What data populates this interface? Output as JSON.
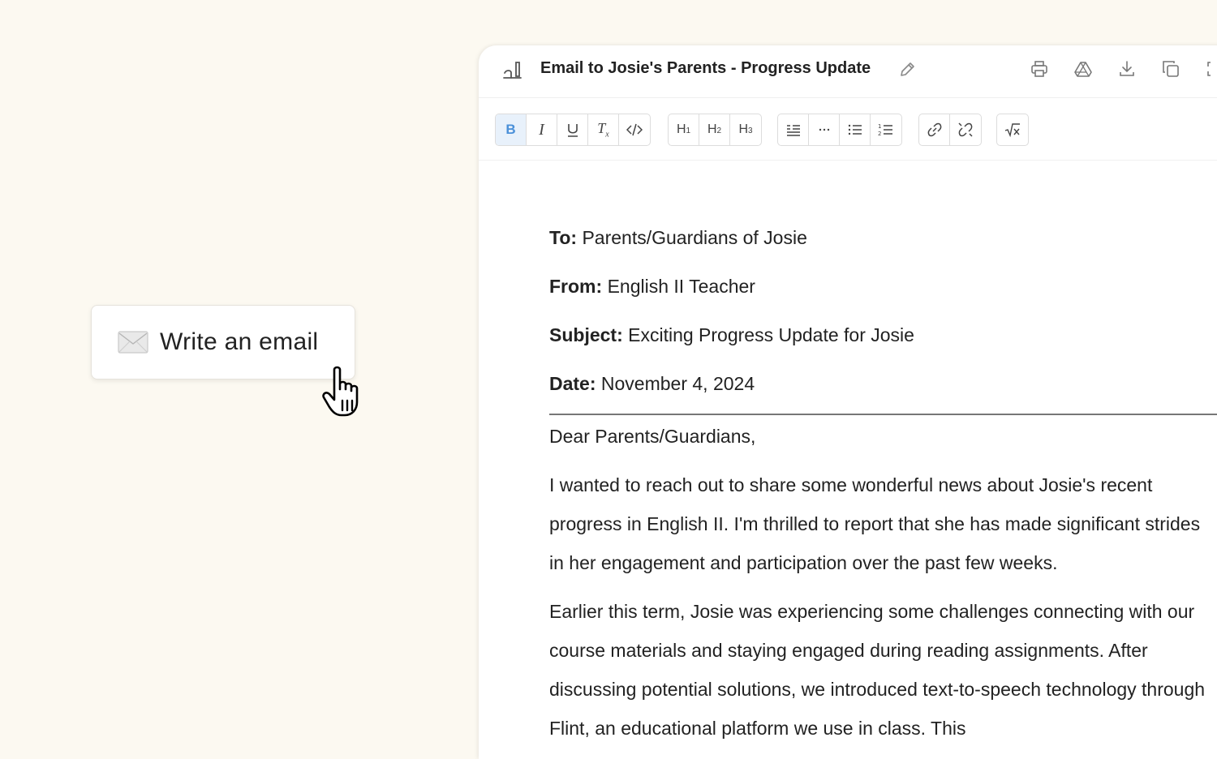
{
  "action_chip": {
    "label": "Write an email",
    "icon": "envelope-icon"
  },
  "document": {
    "title": "Email to Josie's Parents - Progress Update",
    "header_actions": [
      "print-icon",
      "drive-icon",
      "download-icon",
      "copy-icon",
      "expand-icon"
    ],
    "toolbar": {
      "groups": [
        [
          "B",
          "I",
          "U",
          "Tx",
          "</>"
        ],
        [
          "H1",
          "H2",
          "H3"
        ],
        [
          "blockquote",
          "divider",
          "bullet-list",
          "numbered-list"
        ],
        [
          "link",
          "unlink"
        ],
        [
          "math"
        ]
      ],
      "active": "B"
    },
    "meta": {
      "to_label": "To:",
      "to_value": "Parents/Guardians of Josie",
      "from_label": "From:",
      "from_value": "English II Teacher",
      "subject_label": "Subject:",
      "subject_value": "Exciting Progress Update for Josie",
      "date_label": "Date:",
      "date_value": "November 4, 2024"
    },
    "greeting": "Dear Parents/Guardians,",
    "paragraph1": "I wanted to reach out to share some wonderful news about Josie's recent progress in English II. I'm thrilled to report that she has made significant strides in her engagement and participation over the past few weeks.",
    "paragraph2": "Earlier this term, Josie was experiencing some challenges connecting with our course materials and staying engaged during reading assignments. After discussing potential solutions, we introduced text-to-speech technology through Flint, an educational platform we use in class. This"
  }
}
